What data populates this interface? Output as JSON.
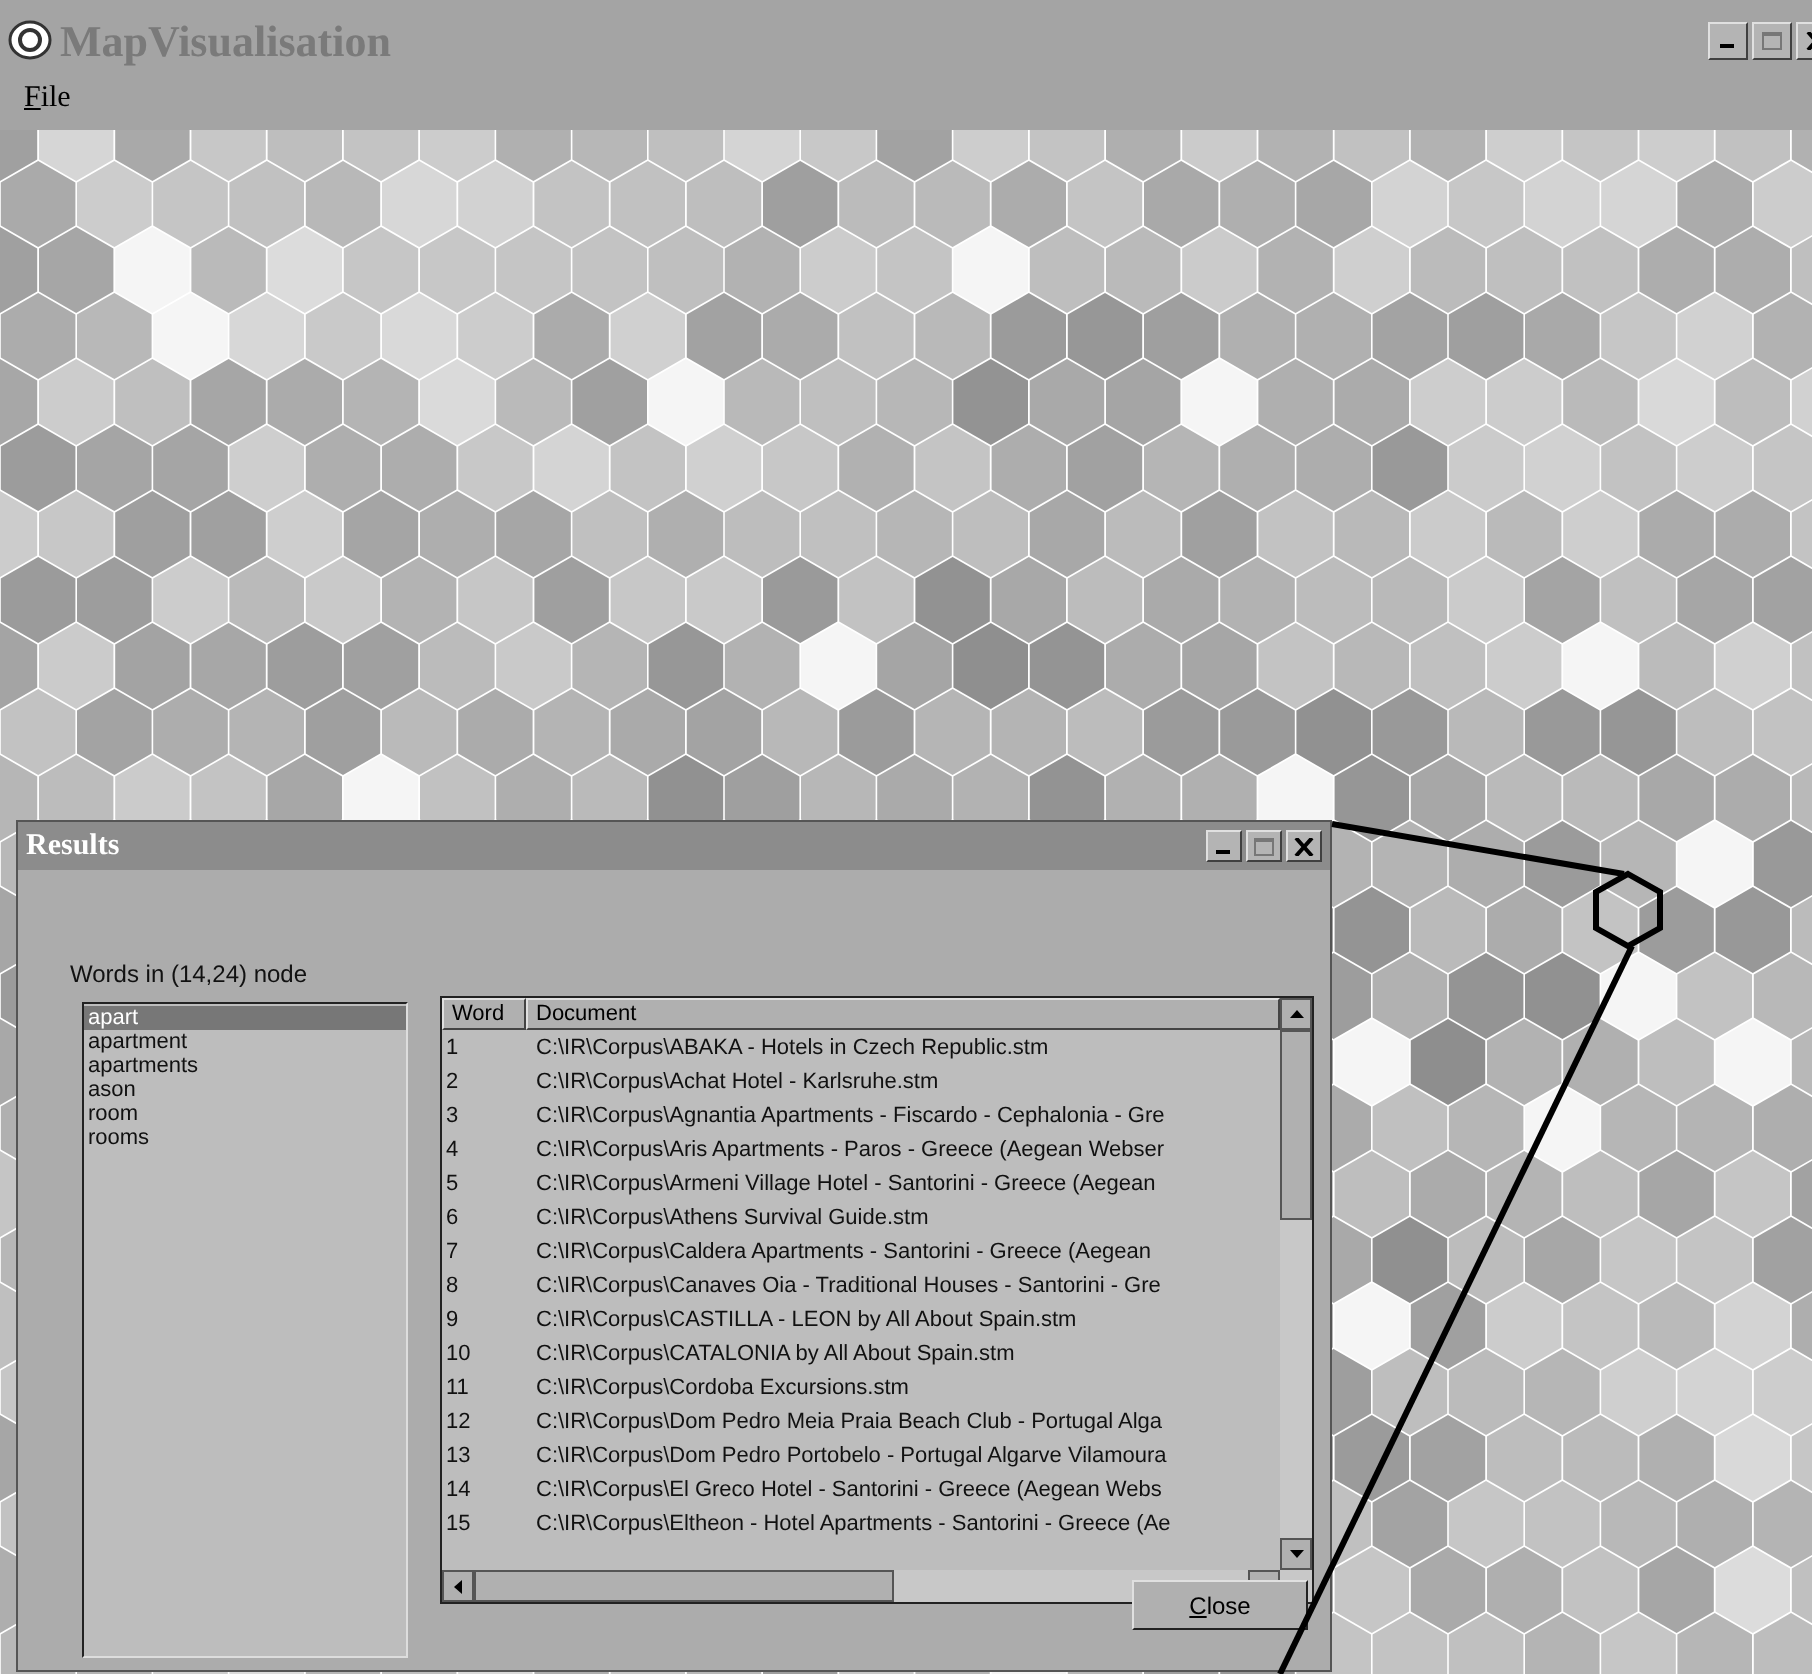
{
  "window": {
    "title": "MapVisualisation"
  },
  "menu": [
    {
      "label": "File"
    }
  ],
  "results": {
    "title": "Results",
    "node_label": "Words in (14,24) node",
    "words": [
      {
        "label": "apart",
        "selected": true
      },
      {
        "label": "apartment",
        "selected": false
      },
      {
        "label": "apartments",
        "selected": false
      },
      {
        "label": "ason",
        "selected": false
      },
      {
        "label": "room",
        "selected": false
      },
      {
        "label": "rooms",
        "selected": false
      }
    ],
    "table": {
      "columns": [
        "Word",
        "Document"
      ],
      "rows": [
        {
          "word": "1",
          "document": "C:\\IR\\Corpus\\ABAKA - Hotels in Czech Republic.stm"
        },
        {
          "word": "2",
          "document": "C:\\IR\\Corpus\\Achat Hotel - Karlsruhe.stm"
        },
        {
          "word": "3",
          "document": "C:\\IR\\Corpus\\Agnantia Apartments - Fiscardo - Cephalonia - Gre"
        },
        {
          "word": "4",
          "document": "C:\\IR\\Corpus\\Aris Apartments - Paros - Greece (Aegean Webser"
        },
        {
          "word": "5",
          "document": "C:\\IR\\Corpus\\Armeni Village Hotel - Santorini - Greece (Aegean"
        },
        {
          "word": "6",
          "document": "C:\\IR\\Corpus\\Athens Survival Guide.stm"
        },
        {
          "word": "7",
          "document": "C:\\IR\\Corpus\\Caldera Apartments - Santorini - Greece (Aegean"
        },
        {
          "word": "8",
          "document": "C:\\IR\\Corpus\\Canaves Oia - Traditional Houses - Santorini - Gre"
        },
        {
          "word": "9",
          "document": "C:\\IR\\Corpus\\CASTILLA - LEON by All About Spain.stm"
        },
        {
          "word": "10",
          "document": "C:\\IR\\Corpus\\CATALONIA by All About Spain.stm"
        },
        {
          "word": "11",
          "document": "C:\\IR\\Corpus\\Cordoba Excursions.stm"
        },
        {
          "word": "12",
          "document": "C:\\IR\\Corpus\\Dom Pedro Meia Praia Beach Club - Portugal Alga"
        },
        {
          "word": "13",
          "document": "C:\\IR\\Corpus\\Dom Pedro Portobelo - Portugal Algarve Vilamoura"
        },
        {
          "word": "14",
          "document": "C:\\IR\\Corpus\\El Greco Hotel - Santorini - Greece (Aegean Webs"
        },
        {
          "word": "15",
          "document": "C:\\IR\\Corpus\\Eltheon - Hotel Apartments - Santorini - Greece (Ae"
        }
      ]
    },
    "close_button": "Close"
  }
}
